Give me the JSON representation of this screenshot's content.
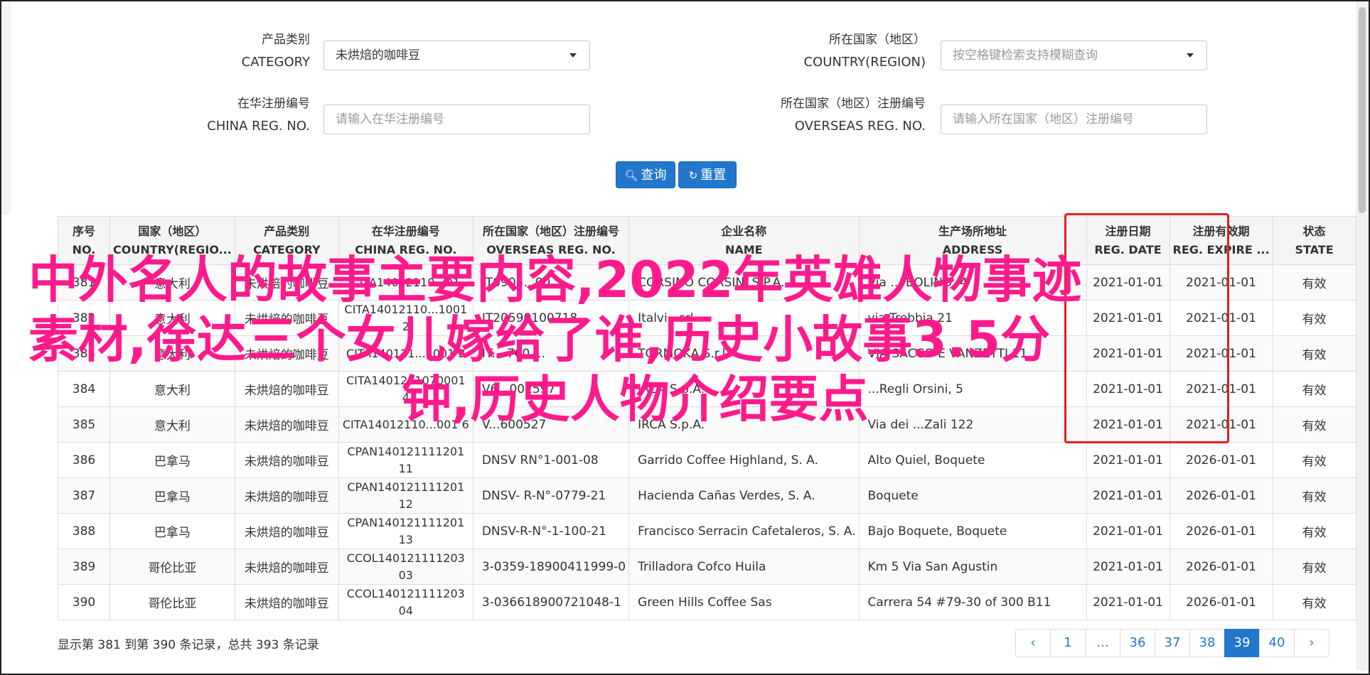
{
  "filters": {
    "category": {
      "label_zh": "产品类别",
      "label_en": "CATEGORY",
      "value": "未烘焙的咖啡豆"
    },
    "country": {
      "label_zh": "所在国家（地区）",
      "label_en": "COUNTRY(REGION)",
      "placeholder": "按空格键检索支持模糊查询"
    },
    "china_reg": {
      "label_zh": "在华注册编号",
      "label_en": "CHINA REG. NO.",
      "placeholder": "请输入在华注册编号"
    },
    "overseas_reg": {
      "label_zh": "所在国家（地区）注册编号",
      "label_en": "OVERSEAS REG. NO.",
      "placeholder": "请输入所在国家（地区）注册编号"
    }
  },
  "buttons": {
    "search": "查询",
    "reset": "重置",
    "search_icon": "search-icon",
    "reset_icon": "refresh-icon"
  },
  "table": {
    "headers": [
      {
        "zh": "序号",
        "en": "NO."
      },
      {
        "zh": "国家（地区）",
        "en": "COUNTRY(REGIO..."
      },
      {
        "zh": "产品类别",
        "en": "CATEGORY"
      },
      {
        "zh": "在华注册编号",
        "en": "CHINA REG. NO."
      },
      {
        "zh": "所在国家（地区）注册编号",
        "en": "OVERSEAS REG. NO."
      },
      {
        "zh": "企业名称",
        "en": "NAME"
      },
      {
        "zh": "生产场所地址",
        "en": "ADDRESS"
      },
      {
        "zh": "注册日期",
        "en": "REG. DATE"
      },
      {
        "zh": "注册有效期",
        "en": "REG. EXPIRE ..."
      },
      {
        "zh": "状态",
        "en": "STATE"
      }
    ],
    "rows": [
      {
        "no": "381",
        "country": "意大利",
        "category": "未烘焙的咖啡豆",
        "china_reg": "CITA14012110...01",
        "overseas_reg": "IT0905...00",
        "name": "CORSINO CORSINI S.P.A.",
        "address": "Via ... BOLINO, 4",
        "reg_date": "2021-01-01",
        "expire": "2021-01-01",
        "state": "有效"
      },
      {
        "no": "382",
        "country": "意大利",
        "category": "未烘焙的咖啡豆",
        "china_reg": "CITA14012110...1001 2",
        "overseas_reg": "IT20590100718",
        "name": "Italvi...srl",
        "address": "via Trebbia 21",
        "reg_date": "2021-01-01",
        "expire": "2021-01-01",
        "state": "有效"
      },
      {
        "no": "383",
        "country": "意大利",
        "category": "未烘焙的咖啡豆",
        "china_reg": "CITA140121...1001 3",
        "overseas_reg": "IT... 760 ...",
        "name": "TORMOKA S.r.l.",
        "address": "VIA SACCO E VANZETTI 11",
        "reg_date": "2021-01-01",
        "expire": "2021-01-01",
        "state": "有效"
      },
      {
        "no": "384",
        "country": "意大利",
        "category": "未烘焙的咖啡豆",
        "china_reg": "CITA1401211070001 4",
        "overseas_reg": "V6...002597",
        "name": "IRCA S.p.A.",
        "address": "...Regli Orsini, 5",
        "reg_date": "2021-01-01",
        "expire": "2021-01-01",
        "state": "有效"
      },
      {
        "no": "385",
        "country": "意大利",
        "category": "未烘焙的咖啡豆",
        "china_reg": "CITA14012110...001 6",
        "overseas_reg": "V...600527",
        "name": "IRCA S.p.A.",
        "address": "Via dei ...Zali 122",
        "reg_date": "2021-01-01",
        "expire": "2021-01-01",
        "state": "有效"
      },
      {
        "no": "386",
        "country": "巴拿马",
        "category": "未烘焙的咖啡豆",
        "china_reg": "CPAN140121111201 11",
        "overseas_reg": "DNSV RN°1-001-08",
        "name": "Garrido Coffee Highland, S. A.",
        "address": "Alto Quiel, Boquete",
        "reg_date": "2021-01-01",
        "expire": "2026-01-01",
        "state": "有效"
      },
      {
        "no": "387",
        "country": "巴拿马",
        "category": "未烘焙的咖啡豆",
        "china_reg": "CPAN140121111201 12",
        "overseas_reg": "DNSV- R-N°-0779-21",
        "name": "Hacienda Cañas Verdes, S. A.",
        "address": "Boquete",
        "reg_date": "2021-01-01",
        "expire": "2026-01-01",
        "state": "有效"
      },
      {
        "no": "388",
        "country": "巴拿马",
        "category": "未烘焙的咖啡豆",
        "china_reg": "CPAN140121111201 13",
        "overseas_reg": "DNSV-R-N°-1-100-21",
        "name": "Francisco Serracin Cafetaleros, S. A.",
        "address": "Bajo Boquete, Boquete",
        "reg_date": "2021-01-01",
        "expire": "2026-01-01",
        "state": "有效"
      },
      {
        "no": "389",
        "country": "哥伦比亚",
        "category": "未烘焙的咖啡豆",
        "china_reg": "CCOL140121111203 03",
        "overseas_reg": "3-0359-18900411999-0",
        "name": "Trilladora Cofco Huila",
        "address": "Km 5 Via San Agustin",
        "reg_date": "2021-01-01",
        "expire": "2026-01-01",
        "state": "有效"
      },
      {
        "no": "390",
        "country": "哥伦比亚",
        "category": "未烘焙的咖啡豆",
        "china_reg": "CCOL140121111203 04",
        "overseas_reg": "3-036618900721048-1",
        "name": "Green Hills Coffee Sas",
        "address": "Carrera 54 #79-30 of 300 B11",
        "reg_date": "2021-01-01",
        "expire": "2026-01-01",
        "state": "有效"
      }
    ]
  },
  "overlay": {
    "line1": "中外名人的故事主要内容,2022年英雄人物事迹",
    "line2": "素材,徐达三个女儿嫁给了谁,历史小故事3.5分",
    "line3": "钟,历史人物介绍要点"
  },
  "summary": "显示第 381 到第 390 条记录，总共 393 条记录",
  "pagination": {
    "items": [
      "‹",
      "1",
      "...",
      "36",
      "37",
      "38",
      "39",
      "40",
      "›"
    ],
    "active": "39"
  },
  "colors": {
    "accent": "#2277cc",
    "highlight": "#e0201b",
    "overlay_text": "#ff1a8c"
  }
}
